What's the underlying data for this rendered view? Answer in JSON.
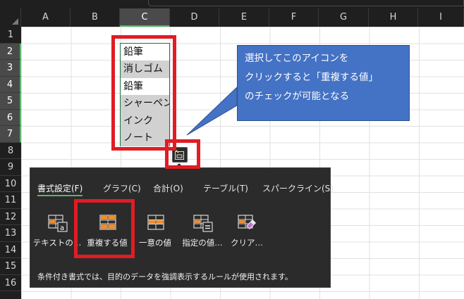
{
  "columns": [
    "A",
    "B",
    "C",
    "D",
    "E",
    "F",
    "G",
    "H",
    "I"
  ],
  "rows": [
    "1",
    "2",
    "3",
    "4",
    "5",
    "6",
    "7",
    "8",
    "9",
    "10",
    "11",
    "12",
    "13",
    "14",
    "15",
    "16"
  ],
  "selection": {
    "column": "C",
    "rows": [
      "2",
      "3",
      "4",
      "5",
      "6",
      "7"
    ]
  },
  "cells": [
    {
      "text": "鉛筆",
      "duplicate": false
    },
    {
      "text": "消しゴム",
      "duplicate": true
    },
    {
      "text": "鉛筆",
      "duplicate": false
    },
    {
      "text": "シャーペン",
      "duplicate": true
    },
    {
      "text": "インク",
      "duplicate": true
    },
    {
      "text": "ノート",
      "duplicate": true
    }
  ],
  "callout": {
    "line1": "選択してこのアイコンを",
    "line2": "クリックすると「重複する値」",
    "line3": "のチェックが可能となる"
  },
  "quick_analysis": {
    "tabs": [
      "書式設定(F)",
      "グラフ(C)",
      "合計(O)",
      "テーブル(T)",
      "スパークライン(S)"
    ],
    "active_tab": "書式設定(F)",
    "tools": [
      "テキストの…",
      "重複する値",
      "一意の値",
      "指定の値…",
      "クリア…"
    ],
    "description": "条件付き書式では、目的のデータを強調表示するルールが使用されます。"
  },
  "colors": {
    "highlight_red": "#e01c24",
    "callout_blue": "#4472c4",
    "accent_green": "#5db36b",
    "icon_orange": "#f28c28",
    "panel_bg": "#2b2b2b"
  },
  "icons": {
    "quick_analysis": "quick-analysis-icon",
    "text_contains": "text-contains-icon",
    "duplicate_values": "duplicate-values-icon",
    "unique_values": "unique-values-icon",
    "equal_to": "equal-to-icon",
    "clear_format": "clear-format-icon"
  }
}
